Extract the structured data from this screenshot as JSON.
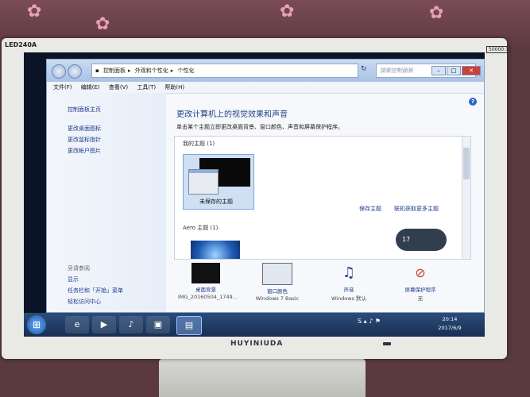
{
  "monitor": {
    "model": "LED240A",
    "contrast_badge": "50000:1",
    "brand": "HUYINIUDA"
  },
  "window": {
    "breadcrumb": [
      "控制面板",
      "外观和个性化",
      "个性化"
    ],
    "search_placeholder": "搜索控制面板",
    "menu": [
      "文件(F)",
      "编辑(E)",
      "查看(V)",
      "工具(T)",
      "帮助(H)"
    ]
  },
  "sidebar": {
    "home": "控制面板主页",
    "links": [
      "更改桌面图标",
      "更改鼠标指针",
      "更改帐户图片"
    ],
    "see_also": "另请参阅",
    "see_also_links": [
      "显示",
      "任务栏和「开始」菜单",
      "轻松访问中心"
    ]
  },
  "main": {
    "title": "更改计算机上的视觉效果和声音",
    "description": "单击某个主题立即更改桌面背景、窗口颜色、声音和屏幕保护程序。",
    "my_themes": "我的主题 (1)",
    "unsaved_theme": "未保存的主题",
    "aero_themes": "Aero 主题 (1)",
    "save_theme": "保存主题",
    "online_themes": "联机获取更多主题",
    "gadget_value": "17",
    "bottom": [
      {
        "label": "桌面背景",
        "sub": "IMG_20160504_1749..."
      },
      {
        "label": "窗口颜色",
        "sub": "Windows 7 Basic"
      },
      {
        "label": "声音",
        "sub": "Windows 默认"
      },
      {
        "label": "屏幕保护程序",
        "sub": "无"
      }
    ]
  },
  "taskbar": {
    "time": "20:14",
    "date": "2017/6/9"
  }
}
